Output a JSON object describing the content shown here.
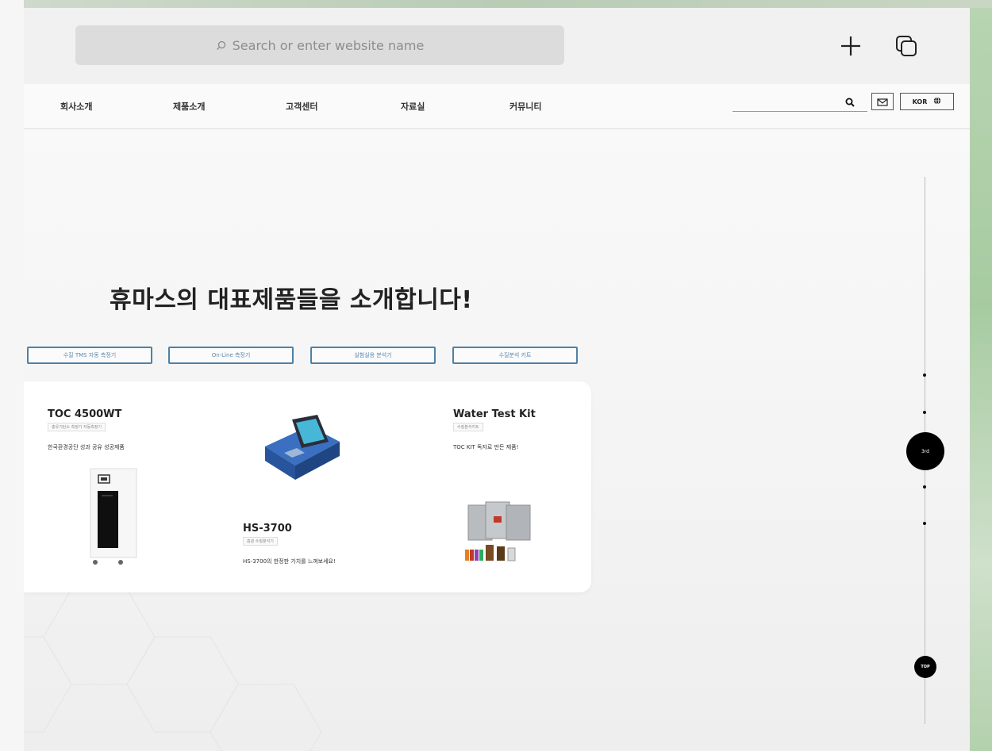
{
  "browser": {
    "search_placeholder": "Search or enter website name",
    "new_tab_icon": "plus-icon",
    "tabs_icon": "tabs-icon"
  },
  "nav": {
    "items": [
      {
        "label": "회사소개"
      },
      {
        "label": "제품소개"
      },
      {
        "label": "고객센터"
      },
      {
        "label": "자료실"
      },
      {
        "label": "커뮤니티"
      }
    ],
    "language": "KOR",
    "search_icon": "search-icon",
    "mail_icon": "mail-icon",
    "globe_icon": "globe-icon"
  },
  "main": {
    "headline": "휴마스의 대표제품들을 소개합니다!",
    "category_tabs": [
      {
        "label": "수질 TMS 자동 측정기"
      },
      {
        "label": "On-Line 측정기"
      },
      {
        "label": "실험실용 분석기"
      },
      {
        "label": "수질분석 키트"
      }
    ],
    "products": [
      {
        "title": "TOC 4500WT",
        "tag": "총유기탄소 측정기 자동측정기",
        "desc": "한국환경공단 성과 공유 성공제품"
      },
      {
        "title": "HS-3700",
        "tag": "흡광 수질분석기",
        "desc": "HS-3700의 한정판 가치를 느껴보세요!"
      },
      {
        "title": "Water Test Kit",
        "tag": "수질분석키트",
        "desc": "TOC KIT 독자로 만든 제품!"
      }
    ]
  },
  "scroll_nav": {
    "active_label": "3rd",
    "top_label": "TOP"
  },
  "colors": {
    "tab_border": "#4d82a7",
    "accent_dark": "#000000"
  }
}
